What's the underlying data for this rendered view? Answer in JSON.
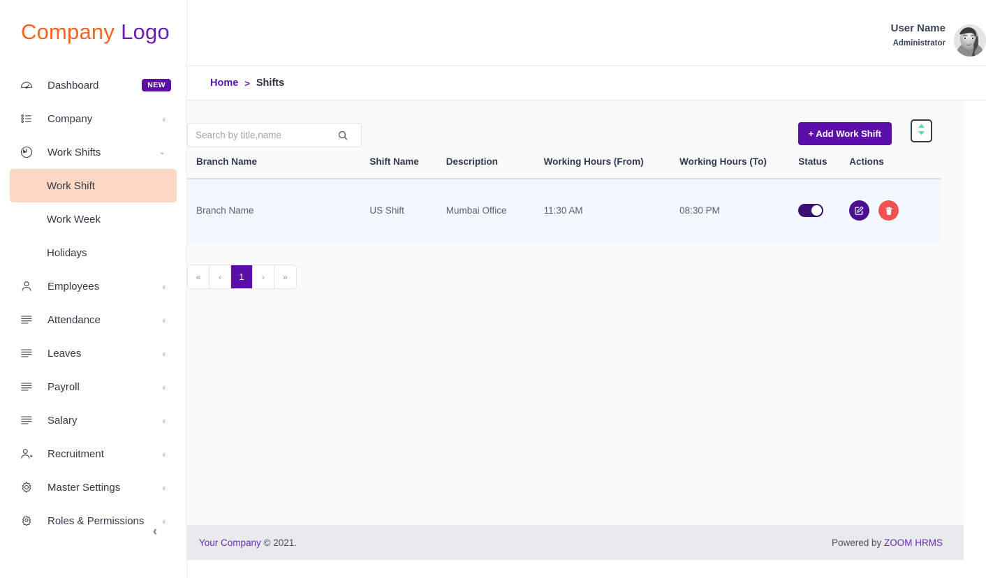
{
  "brand": {
    "part1": "Company",
    "part2": "Logo"
  },
  "sidebar": {
    "items": [
      {
        "label": "Dashboard",
        "icon": "gauge-icon",
        "badge": "NEW"
      },
      {
        "label": "Company",
        "icon": "list-icon",
        "caret": "‹"
      },
      {
        "label": "Work Shifts",
        "icon": "clock-icon",
        "caret": "⌄"
      },
      {
        "label": "Employees",
        "icon": "user-icon",
        "caret": "‹"
      },
      {
        "label": "Attendance",
        "icon": "lines-icon",
        "caret": "‹"
      },
      {
        "label": "Leaves",
        "icon": "lines-icon",
        "caret": "‹"
      },
      {
        "label": "Payroll",
        "icon": "lines-icon",
        "caret": "‹"
      },
      {
        "label": "Salary",
        "icon": "lines-icon",
        "caret": "‹"
      },
      {
        "label": "Recruitment",
        "icon": "user-plus-icon",
        "caret": "‹"
      },
      {
        "label": "Master Settings",
        "icon": "gear-icon",
        "caret": "‹"
      },
      {
        "label": "Roles & Permissions",
        "icon": "gear-user-icon",
        "caret": "‹"
      }
    ],
    "submenu": [
      {
        "label": "Work Shift",
        "active": true
      },
      {
        "label": "Work Week",
        "active": false
      },
      {
        "label": "Holidays",
        "active": false
      }
    ],
    "collapse_icon": "‹"
  },
  "header": {
    "user_name": "User Name",
    "user_role": "Administrator",
    "avatar_name": "user-avatar"
  },
  "breadcrumb": {
    "home": "Home",
    "separator": ">",
    "current": "Shifts"
  },
  "toolbar": {
    "search_placeholder": "Search by title,name",
    "search_value": "",
    "add_label": "+ Add Work Shift",
    "sort_icon": "sort-arrows-icon"
  },
  "table": {
    "columns": [
      "Branch Name",
      "Shift Name",
      "Description",
      "Working Hours (From)",
      "Working Hours (To)",
      "Status",
      "Actions"
    ],
    "rows": [
      {
        "branch_name": "Branch Name",
        "shift_name": "US Shift",
        "description": "Mumbai Office",
        "hours_from": "11:30 AM",
        "hours_to": "08:30 PM",
        "status_on": true
      }
    ]
  },
  "pagination": {
    "first": "«",
    "prev": "‹",
    "pages": [
      "1"
    ],
    "next": "›",
    "last": "»",
    "current": "1"
  },
  "footer": {
    "company": "Your Company",
    "copyright": " © 2021.",
    "powered_prefix": "Powered by ",
    "powered_brand": "ZOOM HRMS"
  },
  "colors": {
    "brand_orange": "#f26522",
    "brand_purple": "#6a1fb5",
    "accent_purple": "#5b0fa8",
    "active_peach": "#fbd8c3",
    "row_blue": "#f2f8fd",
    "delete_red": "#ef5350",
    "sort_green": "#5fdda8"
  }
}
